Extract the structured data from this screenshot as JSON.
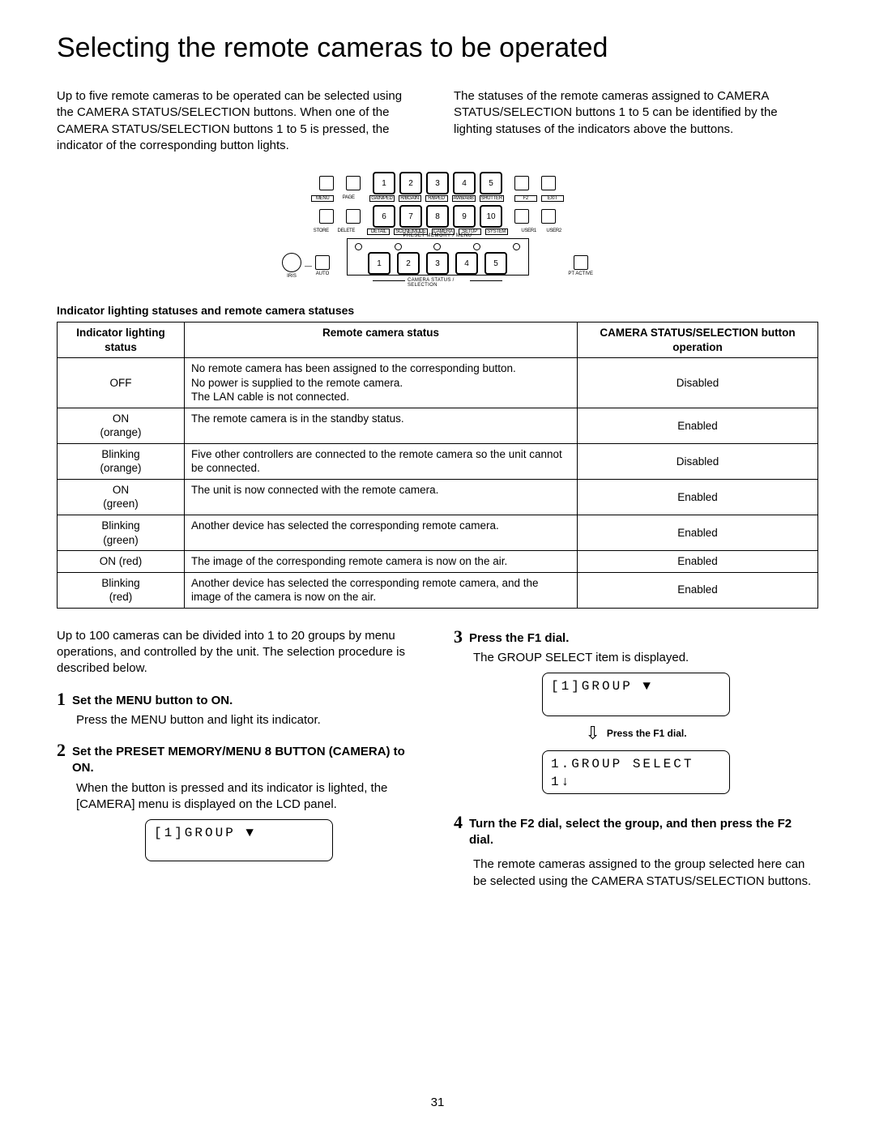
{
  "title": "Selecting the remote cameras to be operated",
  "intro_left": "Up to five remote cameras to be operated can be selected using the CAMERA STATUS/SELECTION buttons. When one of the CAMERA STATUS/SELECTION buttons 1 to 5 is pressed, the indicator of the corresponding button lights.",
  "intro_right": "The statuses of the remote cameras assigned to CAMERA STATUS/SELECTION buttons 1 to 5 can be identified by the lighting statuses of the indicators above the buttons.",
  "panel": {
    "row1": [
      "1",
      "2",
      "3",
      "4",
      "5"
    ],
    "row1_lbls_left": [
      "MENU",
      "PAGE"
    ],
    "row1_lbls": [
      "GAIN/PED",
      "R/BGAIN",
      "R/BPED",
      "AWB/ABB",
      "SHUTTER",
      "F2",
      "EXIT"
    ],
    "row2": [
      "6",
      "7",
      "8",
      "9",
      "10"
    ],
    "row2_lbls_left": [
      "STORE",
      "DELETE"
    ],
    "row2_lbls": [
      "DETAIL",
      "SCENE/MODE",
      "CAMERA",
      "SETUP",
      "SYSTEM",
      "USER1",
      "USER2"
    ],
    "pml": "PRESET MEMORY / MENU",
    "row3": [
      "1",
      "2",
      "3",
      "4",
      "5"
    ],
    "iris": "IRIS",
    "auto": "AUTO",
    "pt": "PT ACTIVE",
    "csl": "CAMERA STATUS / SELECTION"
  },
  "table_heading": "Indicator lighting statuses and remote camera statuses",
  "th": [
    "Indicator lighting status",
    "Remote camera status",
    "CAMERA STATUS/SELECTION button operation"
  ],
  "rows": [
    {
      "a": "OFF",
      "b": "No remote camera has been assigned to the corresponding button.\nNo power is supplied to the remote camera.\nThe LAN cable is not connected.",
      "c": "Disabled"
    },
    {
      "a": "ON (orange)",
      "b": "The remote camera is in the standby status.",
      "c": "Enabled"
    },
    {
      "a": "Blinking (orange)",
      "b": "Five other controllers are connected to the remote camera so the unit cannot be connected.",
      "c": "Disabled"
    },
    {
      "a": "ON (green)",
      "b": "The unit is now connected with the remote camera.",
      "c": "Enabled"
    },
    {
      "a": "Blinking (green)",
      "b": "Another device has selected the corresponding remote camera.",
      "c": "Enabled"
    },
    {
      "a": "ON (red)",
      "b": "The image of the corresponding remote camera is now on the air.",
      "c": "Enabled"
    },
    {
      "a": "Blinking (red)",
      "b": "Another device has selected the corresponding remote camera, and the image of the camera is now on the air.",
      "c": "Enabled"
    }
  ],
  "left_text": "Up to 100 cameras can be divided into 1 to 20 groups by menu operations, and controlled by the unit. The selection procedure is described below.",
  "s1_t": "Set the MENU button to ON.",
  "s1_b": "Press the MENU button and light its indicator.",
  "s2_t": "Set the PRESET MEMORY/MENU 8 BUTTON (CAMERA) to ON.",
  "s2_b": "When the button is pressed and its indicator is lighted, the [CAMERA] menu is displayed on the LCD panel.",
  "lcd1": "[1]GROUP        ▼",
  "s3_t": "Press the F1 dial.",
  "s3_b": "The GROUP SELECT item is displayed.",
  "flow_top": "[1]GROUP        ▼",
  "flow_lbl": "Press the F1 dial.",
  "flow_bot1": "1.GROUP SELECT",
  "flow_bot2": "             1↓",
  "s4_t": "Turn the F2 dial, select the group, and then press the F2 dial.",
  "s4_b": "The remote cameras assigned to the group selected here can be selected using the CAMERA STATUS/SELECTION buttons.",
  "page_number": "31"
}
